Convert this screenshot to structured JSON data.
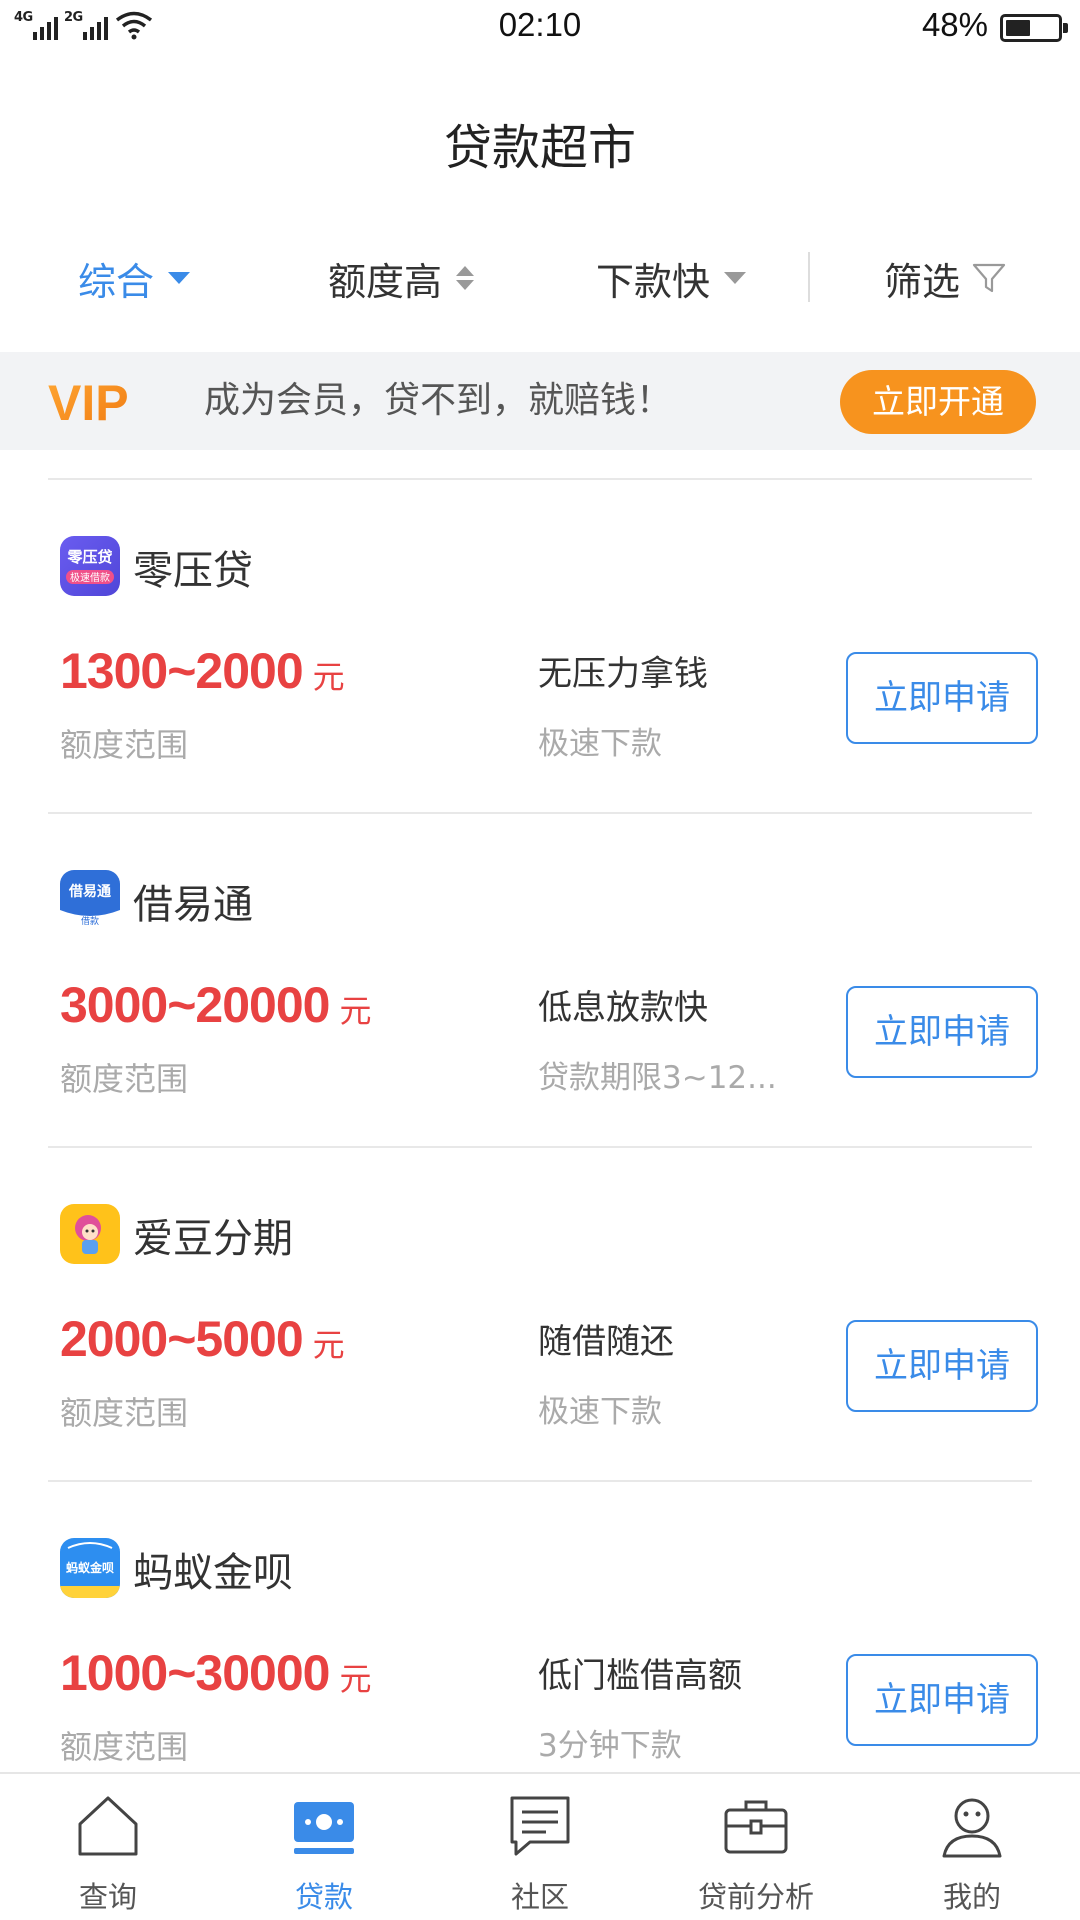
{
  "status_bar": {
    "signal_1": "4G",
    "signal_2": "2G",
    "time": "02:10",
    "battery": "48%",
    "battery_level": 0.48
  },
  "header": {
    "title": "贷款超市"
  },
  "filters": {
    "comprehensive": "综合",
    "high_limit": "额度高",
    "fast_payout": "下款快",
    "filter": "筛选",
    "active": "comprehensive"
  },
  "vip_banner": {
    "logo_text": "VIP",
    "text": "成为会员，贷不到，就赔钱！",
    "button": "立即开通"
  },
  "loans": [
    {
      "name": "零压贷",
      "logo_text": "零压贷",
      "logo_sub": "极速借款",
      "amount": "1300~2000",
      "unit": "元",
      "range_label": "额度范围",
      "feature": "无压力拿钱",
      "sub": "极速下款",
      "button": "立即申请"
    },
    {
      "name": "借易通",
      "logo_text": "借易通",
      "logo_sub": "借款",
      "amount": "3000~20000",
      "unit": "元",
      "range_label": "额度范围",
      "feature": "低息放款快",
      "sub": "贷款期限3~12...",
      "button": "立即申请"
    },
    {
      "name": "爱豆分期",
      "amount": "2000~5000",
      "unit": "元",
      "range_label": "额度范围",
      "feature": "随借随还",
      "sub": "极速下款",
      "button": "立即申请"
    },
    {
      "name": "蚂蚁金呗",
      "logo_text": "蚂蚁金呗",
      "amount": "1000~30000",
      "unit": "元",
      "range_label": "额度范围",
      "feature": "低门槛借高额",
      "sub": "3分钟下款",
      "button": "立即申请"
    }
  ],
  "tabs": [
    {
      "label": "查询",
      "icon": "house-icon"
    },
    {
      "label": "贷款",
      "icon": "loan-icon",
      "active": true
    },
    {
      "label": "社区",
      "icon": "document-icon"
    },
    {
      "label": "贷前分析",
      "icon": "briefcase-icon"
    },
    {
      "label": "我的",
      "icon": "person-icon"
    }
  ],
  "colors": {
    "accent": "#3a8be8",
    "amount": "#e84242",
    "vip_button": "#f7931e",
    "banner_bg": "#f2f3f5"
  }
}
